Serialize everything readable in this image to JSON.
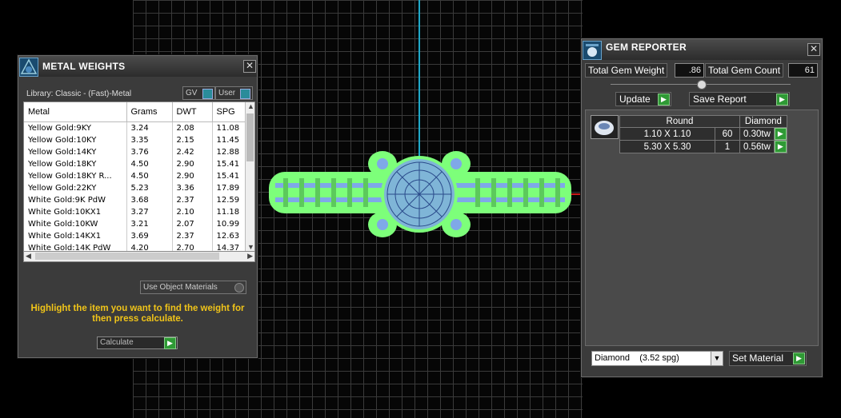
{
  "metal_weights": {
    "title": "METAL WEIGHTS",
    "close": "✕",
    "library_label": "Library: Classic - (Fast)-Metal",
    "gv_label": "GV",
    "user_label": "User",
    "columns": [
      "Metal",
      "Grams",
      "DWT",
      "SPG"
    ],
    "rows": [
      [
        "Yellow Gold:9KY",
        "3.24",
        "2.08",
        "11.08"
      ],
      [
        "Yellow Gold:10KY",
        "3.35",
        "2.15",
        "11.45"
      ],
      [
        "Yellow Gold:14KY",
        "3.76",
        "2.42",
        "12.88"
      ],
      [
        "Yellow Gold:18KY",
        "4.50",
        "2.90",
        "15.41"
      ],
      [
        "Yellow Gold:18KY R...",
        "4.50",
        "2.90",
        "15.41"
      ],
      [
        "Yellow Gold:22KY",
        "5.23",
        "3.36",
        "17.89"
      ],
      [
        "White Gold:9K PdW",
        "3.68",
        "2.37",
        "12.59"
      ],
      [
        "White Gold:10KX1",
        "3.27",
        "2.10",
        "11.18"
      ],
      [
        "White Gold:10KW",
        "3.21",
        "2.07",
        "10.99"
      ],
      [
        "White Gold:14KX1",
        "3.69",
        "2.37",
        "12.63"
      ],
      [
        "White Gold:14K PdW",
        "4.20",
        "2.70",
        "14.37"
      ]
    ],
    "use_object_materials": "Use Object Materials",
    "hint": "Highlight the item you want to find the weight for then press calculate.",
    "calculate": "Calculate"
  },
  "gem_reporter": {
    "title": "GEM REPORTER",
    "close": "✕",
    "total_weight_label": "Total Gem Weight",
    "total_weight_value": ".86",
    "total_count_label": "Total Gem Count",
    "total_count_value": "61",
    "update": "Update",
    "save_report": "Save Report",
    "shape_header": "Round",
    "stone_header": "Diamond",
    "gems": [
      {
        "size": "1.10 X 1.10",
        "count": "60",
        "weight": "0.30tw"
      },
      {
        "size": "5.30 X 5.30",
        "count": "1",
        "weight": "0.56tw"
      }
    ],
    "material": "Diamond    (3.52 spg)",
    "set_material": "Set Material"
  },
  "colors": {
    "ring_green": "#7dff7a",
    "ring_blue": "#7fa8e8",
    "hint_yellow": "#f0c419",
    "axis_cyan": "#1fa8c8",
    "axis_red": "#c81818"
  }
}
